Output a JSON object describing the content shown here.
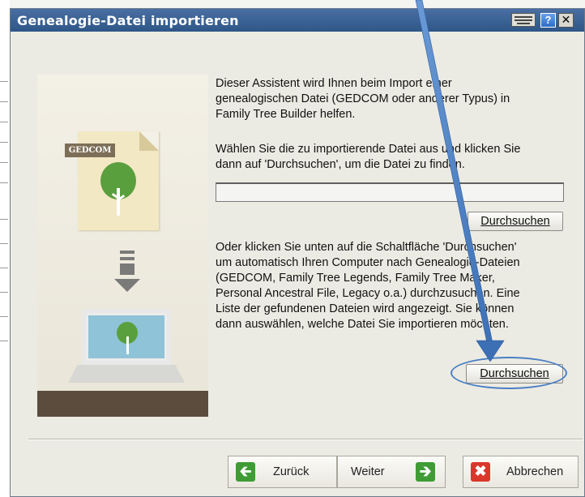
{
  "window": {
    "title": "Genealogie-Datei importieren",
    "help_label": "?",
    "close_label": "✕"
  },
  "illustration": {
    "doc_tag": "GEDCOM"
  },
  "content": {
    "intro_lines": [
      "Dieser Assistent wird Ihnen beim Import einer",
      "genealogischen Datei (GEDCOM oder anderer Typus) in",
      "Family Tree Builder helfen."
    ],
    "select_lines": [
      "Wählen Sie die zu importierende Datei aus und klicken Sie",
      "dann auf 'Durchsuchen', um die Datei zu finden."
    ],
    "path_value": "",
    "browse_label": "Durchsuchen",
    "search_lines": [
      "Oder klicken Sie unten auf die Schaltfläche 'Durchsuchen'",
      "um automatisch Ihren Computer nach Genealogie-Dateien",
      "(GEDCOM, Family Tree Legends, Family Tree Maker,",
      "Personal Ancestral File, Legacy o.a.) durchzusuchen. Eine",
      "Liste der gefundenen Dateien wird angezeigt. Sie können",
      "dann auswählen, welche Datei Sie importieren möchten."
    ],
    "auto_search_label": "Durchsuchen"
  },
  "footer": {
    "back_label": "Zurück",
    "next_label": "Weiter",
    "cancel_label": "Abbrechen"
  },
  "colors": {
    "title_bar": "#2e5687",
    "annotation": "#4a7fc4",
    "back_icon": "#3f9c35",
    "cancel_icon": "#d9372b"
  },
  "icons": {
    "back": "arrow-left-icon",
    "next": "arrow-right-icon",
    "cancel": "x-icon"
  }
}
